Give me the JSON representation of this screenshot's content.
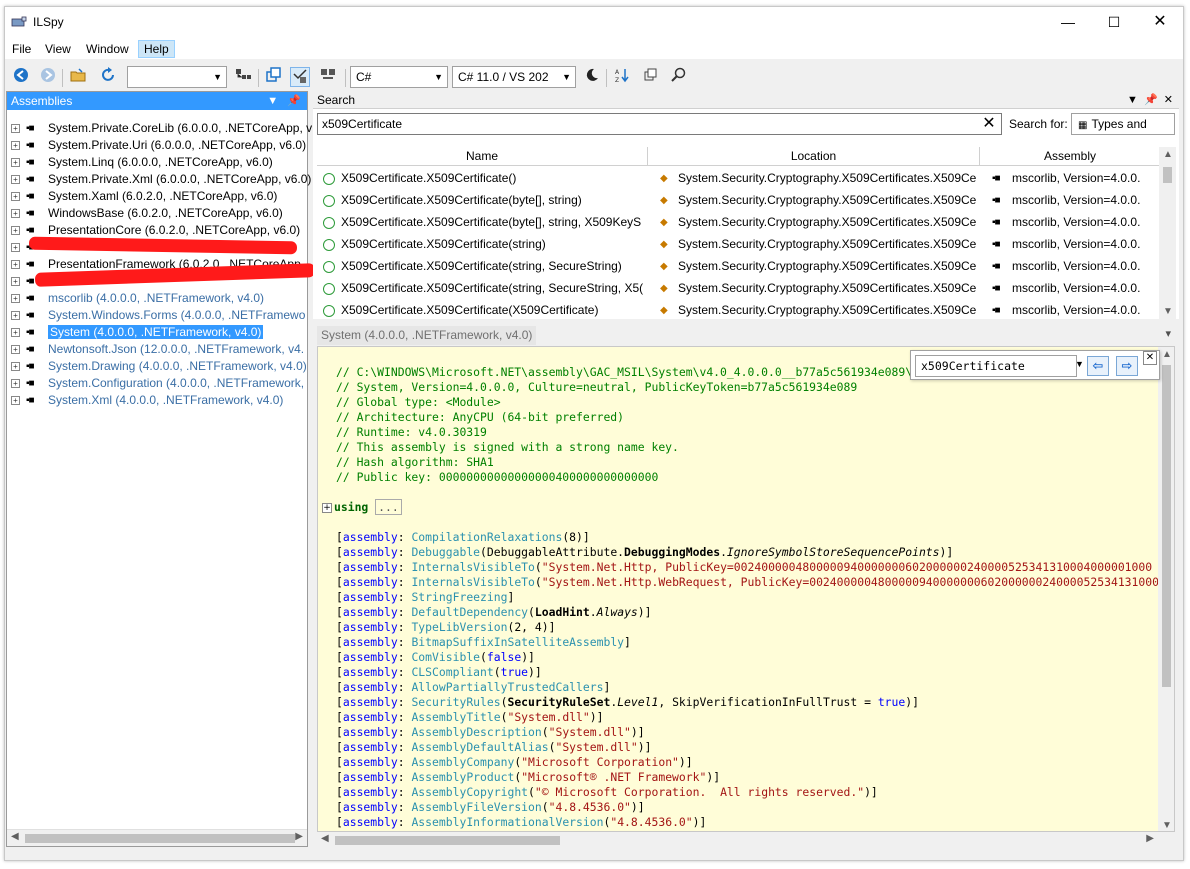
{
  "window": {
    "title": "ILSpy",
    "minimize": "—",
    "maximize": "☐",
    "close": "✕"
  },
  "menu": [
    "File",
    "View",
    "Window",
    "Help"
  ],
  "toolbar": {
    "assembly_list_combo": "",
    "language_combo": "C#",
    "version_combo": "C# 11.0 / VS 202",
    "icons": [
      "back-icon",
      "forward-icon",
      "open-icon",
      "reload-icon",
      "add-assembly-icon",
      "collapse-icon",
      "show-all-members-icon",
      "show-api-only-icon",
      "theme-icon",
      "sort-icon",
      "manage-assemblies-icon",
      "search-icon"
    ]
  },
  "assemblies_pane": {
    "header": "Assemblies",
    "items": [
      {
        "label": "System.Private.CoreLib (6.0.0.0, .NETCoreApp, v",
        "state": "normal"
      },
      {
        "label": "System.Private.Uri (6.0.0.0, .NETCoreApp, v6.0)",
        "state": "normal"
      },
      {
        "label": "System.Linq (6.0.0.0, .NETCoreApp, v6.0)",
        "state": "normal"
      },
      {
        "label": "System.Private.Xml (6.0.0.0, .NETCoreApp, v6.0)",
        "state": "normal"
      },
      {
        "label": "System.Xaml (6.0.2.0, .NETCoreApp, v6.0)",
        "state": "normal"
      },
      {
        "label": "WindowsBase (6.0.2.0, .NETCoreApp, v6.0)",
        "state": "normal"
      },
      {
        "label": "PresentationCore (6.0.2.0, .NETCoreApp, v6.0)",
        "state": "normal"
      },
      {
        "label": "",
        "state": "redacted"
      },
      {
        "label": "PresentationFramework (6.0.2.0, .NETCoreApp,",
        "state": "normal"
      },
      {
        "label": "",
        "state": "redacted"
      },
      {
        "label": "mscorlib (4.0.0.0, .NETFramework, v4.0)",
        "state": "gray"
      },
      {
        "label": "System.Windows.Forms (4.0.0.0, .NETFramewo",
        "state": "gray"
      },
      {
        "label": "System (4.0.0.0, .NETFramework, v4.0)",
        "state": "selected"
      },
      {
        "label": "Newtonsoft.Json (12.0.0.0, .NETFramework, v4.",
        "state": "gray"
      },
      {
        "label": "System.Drawing (4.0.0.0, .NETFramework, v4.0)",
        "state": "gray"
      },
      {
        "label": "System.Configuration (4.0.0.0, .NETFramework,",
        "state": "gray"
      },
      {
        "label": "System.Xml (4.0.0.0, .NETFramework, v4.0)",
        "state": "gray"
      }
    ]
  },
  "search_pane": {
    "header": "Search",
    "query": "x509Certificate",
    "search_for_label": "Search for:",
    "search_for_value": "Types and",
    "columns": [
      "Name",
      "Location",
      "Assembly"
    ],
    "results": [
      {
        "name": "X509Certificate.X509Certificate()",
        "location": "System.Security.Cryptography.X509Certificates.X509Ce",
        "assembly": "mscorlib, Version=4.0.0."
      },
      {
        "name": "X509Certificate.X509Certificate(byte[], string)",
        "location": "System.Security.Cryptography.X509Certificates.X509Ce",
        "assembly": "mscorlib, Version=4.0.0."
      },
      {
        "name": "X509Certificate.X509Certificate(byte[], string, X509KeyS",
        "location": "System.Security.Cryptography.X509Certificates.X509Ce",
        "assembly": "mscorlib, Version=4.0.0."
      },
      {
        "name": "X509Certificate.X509Certificate(string)",
        "location": "System.Security.Cryptography.X509Certificates.X509Ce",
        "assembly": "mscorlib, Version=4.0.0."
      },
      {
        "name": "X509Certificate.X509Certificate(string, SecureString)",
        "location": "System.Security.Cryptography.X509Certificates.X509Ce",
        "assembly": "mscorlib, Version=4.0.0."
      },
      {
        "name": "X509Certificate.X509Certificate(string, SecureString, X5(",
        "location": "System.Security.Cryptography.X509Certificates.X509Ce",
        "assembly": "mscorlib, Version=4.0.0."
      },
      {
        "name": "X509Certificate.X509Certificate(X509Certificate)",
        "location": "System.Security.Cryptography.X509Certificates.X509Ce",
        "assembly": "mscorlib, Version=4.0.0."
      }
    ]
  },
  "document": {
    "tab_label": "System (4.0.0.0, .NETFramework, v4.0)",
    "find_text": "x509Certificate"
  }
}
